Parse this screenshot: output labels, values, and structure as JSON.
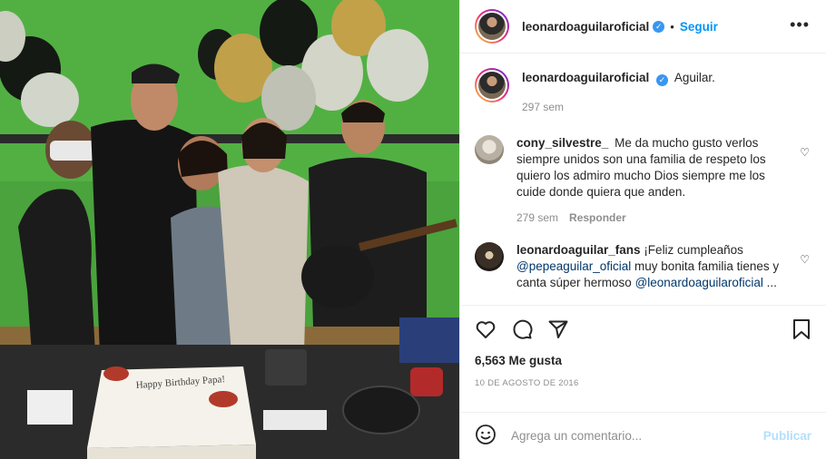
{
  "post": {
    "photo_alt": "",
    "cake_text": "Happy Birthday Papa!"
  },
  "header": {
    "username": "leonardoaguilaroficial",
    "verified_icon": "verified-badge-icon",
    "dot": "•",
    "follow_label": "Seguir",
    "more_icon": "more-options-icon",
    "more_glyph": "•••"
  },
  "caption": {
    "username": "leonardoaguilaroficial",
    "text": "Aguilar.",
    "time": "297 sem"
  },
  "comments": [
    {
      "username": "cony_silvestre_",
      "text": "Me da mucho gusto verlos siempre unidos son una familia de respeto los quiero los admiro mucho Dios siempre me los cuide donde quiera que anden.",
      "time": "279 sem",
      "reply_label": "Responder"
    },
    {
      "username": "leonardoaguilar_fans",
      "text_before": "¡Feliz cumpleaños ",
      "mention1": "@pepeaguilar_oficial",
      "text_middle": " muy bonita familia tienes y canta súper hermoso ",
      "mention2": "@leonardoaguilaroficial",
      "text_after": " ..."
    }
  ],
  "actions": {
    "like_icon": "heart-icon",
    "comment_icon": "comment-icon",
    "share_icon": "share-icon",
    "save_icon": "bookmark-icon",
    "likes": "6,563 Me gusta",
    "date": "10 DE AGOSTO DE 2016"
  },
  "add_comment": {
    "emoji_icon": "emoji-icon",
    "placeholder": "Agrega un comentario...",
    "publish_label": "Publicar"
  },
  "colors": {
    "link": "#0095f6",
    "mention": "#00376b",
    "muted": "#8e8e8e",
    "publish_disabled": "#b2dffc"
  }
}
